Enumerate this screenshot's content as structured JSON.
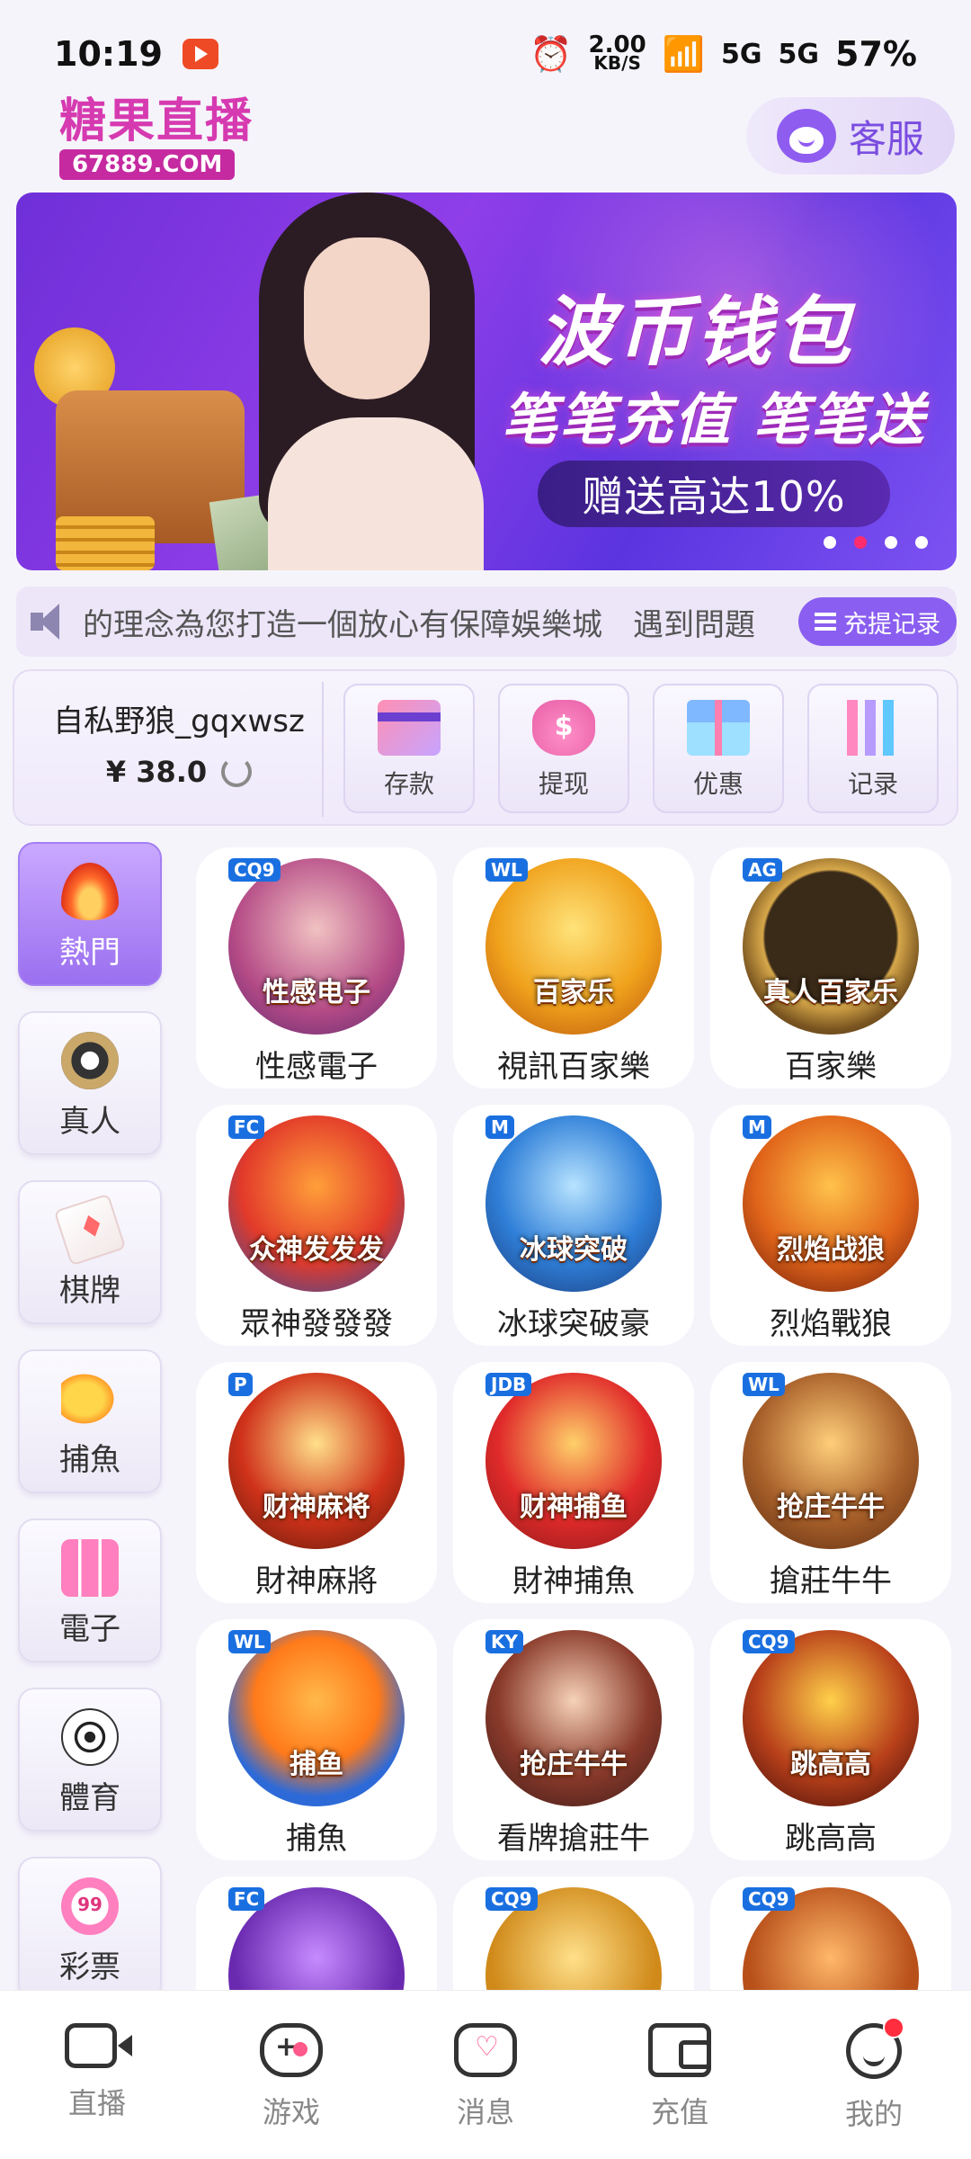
{
  "status_bar": {
    "time": "10:19",
    "net_speed": "2.00",
    "net_unit": "KB/S",
    "signal1": "5G",
    "signal2": "5G",
    "battery": "57%"
  },
  "header": {
    "logo_text": "糖果直播",
    "logo_domain": "67889.COM",
    "service_label": "客服"
  },
  "banner": {
    "title": "波币钱包",
    "subtitle": "笔笔充值 笔笔送",
    "pill": "赠送高达10%",
    "dot_count": 4,
    "active_dot": 1
  },
  "marquee": {
    "text": "的理念為您打造一個放心有保障娛樂城　遇到問題",
    "record_button": "充提记录"
  },
  "user": {
    "name": "自私野狼_gqxwsz",
    "balance": "¥ 38.0"
  },
  "actions": [
    {
      "label": "存款",
      "icon": "card-icon"
    },
    {
      "label": "提现",
      "icon": "money-bag-icon"
    },
    {
      "label": "优惠",
      "icon": "gift-icon"
    },
    {
      "label": "记录",
      "icon": "bar-chart-icon"
    }
  ],
  "categories": [
    {
      "label": "熱門",
      "icon": "fire-icon",
      "active": true
    },
    {
      "label": "真人",
      "icon": "casino-chip-icon"
    },
    {
      "label": "棋牌",
      "icon": "playing-card-icon"
    },
    {
      "label": "捕魚",
      "icon": "fish-icon"
    },
    {
      "label": "電子",
      "icon": "slot-machine-icon"
    },
    {
      "label": "體育",
      "icon": "soccer-ball-icon"
    },
    {
      "label": "彩票",
      "icon": "lottery-ball-icon"
    }
  ],
  "games": [
    {
      "label": "性感電子",
      "vendor": "CQ9",
      "caption": "性感电子"
    },
    {
      "label": "視訊百家樂",
      "vendor": "WL",
      "caption": "百家乐"
    },
    {
      "label": "百家樂",
      "vendor": "AG",
      "caption": "真人百家乐"
    },
    {
      "label": "眾神發發發",
      "vendor": "FC",
      "caption": "众神发发发"
    },
    {
      "label": "冰球突破豪",
      "vendor": "M",
      "caption": "冰球突破"
    },
    {
      "label": "烈焰戰狼",
      "vendor": "M",
      "caption": "烈焰战狼"
    },
    {
      "label": "財神麻將",
      "vendor": "P",
      "caption": "财神麻将"
    },
    {
      "label": "財神捕魚",
      "vendor": "JDB",
      "caption": "财神捕鱼"
    },
    {
      "label": "搶莊牛牛",
      "vendor": "WL",
      "caption": "抢庄牛牛"
    },
    {
      "label": "捕魚",
      "vendor": "WL",
      "caption": "捕鱼"
    },
    {
      "label": "看牌搶莊牛",
      "vendor": "KY",
      "caption": "抢庄牛牛"
    },
    {
      "label": "跳高高",
      "vendor": "CQ9",
      "caption": "跳高高"
    },
    {
      "label": "",
      "vendor": "FC",
      "caption": ""
    },
    {
      "label": "",
      "vendor": "CQ9",
      "caption": ""
    },
    {
      "label": "",
      "vendor": "CQ9",
      "caption": ""
    }
  ],
  "bottom_nav": [
    {
      "label": "直播",
      "icon": "video-camera-icon"
    },
    {
      "label": "游戏",
      "icon": "gamepad-icon"
    },
    {
      "label": "消息",
      "icon": "chat-bubble-icon"
    },
    {
      "label": "充值",
      "icon": "wallet-icon"
    },
    {
      "label": "我的",
      "icon": "smiley-face-icon",
      "badge": true
    }
  ],
  "colors": {
    "accent": "#8a5ef0",
    "brand": "#c52aa0",
    "badge": "#ff2d3d"
  }
}
